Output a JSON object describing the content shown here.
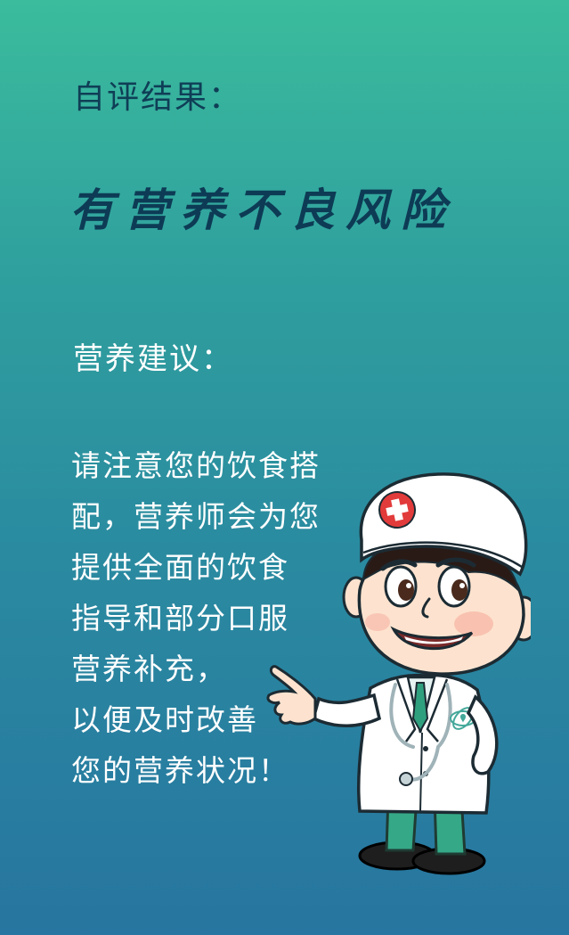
{
  "result": {
    "label": "自评结果：",
    "value": "有营养不良风险"
  },
  "advice": {
    "label": "营养建议：",
    "lines": [
      "请注意您的饮食搭",
      "配，营养师会为您",
      "提供全面的饮食",
      "指导和部分口服",
      "营养补充，",
      "以便及时改善",
      "您的营养状况！"
    ]
  },
  "colors": {
    "background_top": "#3bbc9d",
    "background_bottom": "#2775a0",
    "heading_text": "#0f3e56",
    "body_text": "#ffffff",
    "cross_red": "#e23b3b",
    "pants_green": "#35a887"
  },
  "illustration": {
    "icon": "doctor-cartoon-icon"
  }
}
